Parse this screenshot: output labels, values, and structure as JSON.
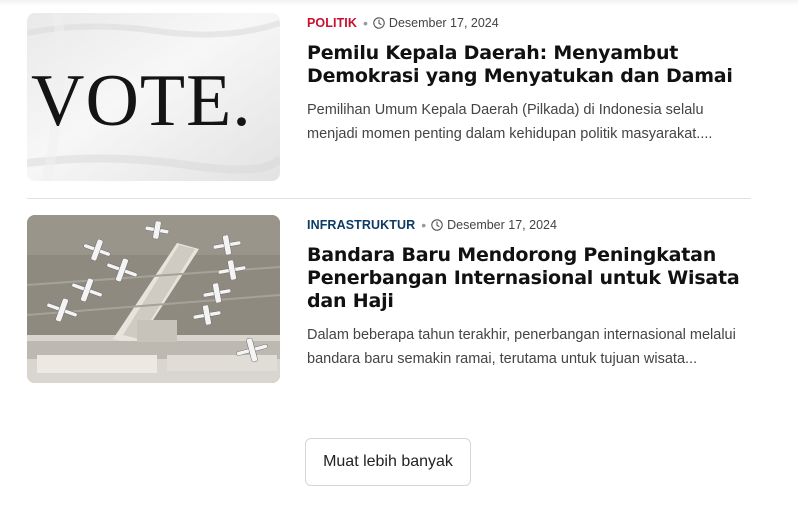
{
  "articles": [
    {
      "category": "POLITIK",
      "date": "Desember 17, 2024",
      "title": "Pemilu Kepala Daerah: Menyambut Demokrasi yang Menyatukan dan Damai",
      "excerpt": "Pemilihan Umum Kepala Daerah (Pilkada) di Indonesia selalu menjadi momen penting dalam kehidupan politik masyarakat....",
      "image_text": "VOTE."
    },
    {
      "category": "INFRASTRUKTUR",
      "date": "Desember 17, 2024",
      "title": "Bandara Baru Mendorong Peningkatan Penerbangan Internasional untuk Wisata dan Haji",
      "excerpt": "Dalam beberapa tahun terakhir, penerbangan internasional melalui bandara baru semakin ramai, terutama untuk tujuan wisata..."
    }
  ],
  "load_more_label": "Muat lebih banyak",
  "colors": {
    "politik": "#c8102e",
    "infrastruktur": "#0d3b66"
  },
  "icons": {
    "meta_time": "clock-icon"
  }
}
